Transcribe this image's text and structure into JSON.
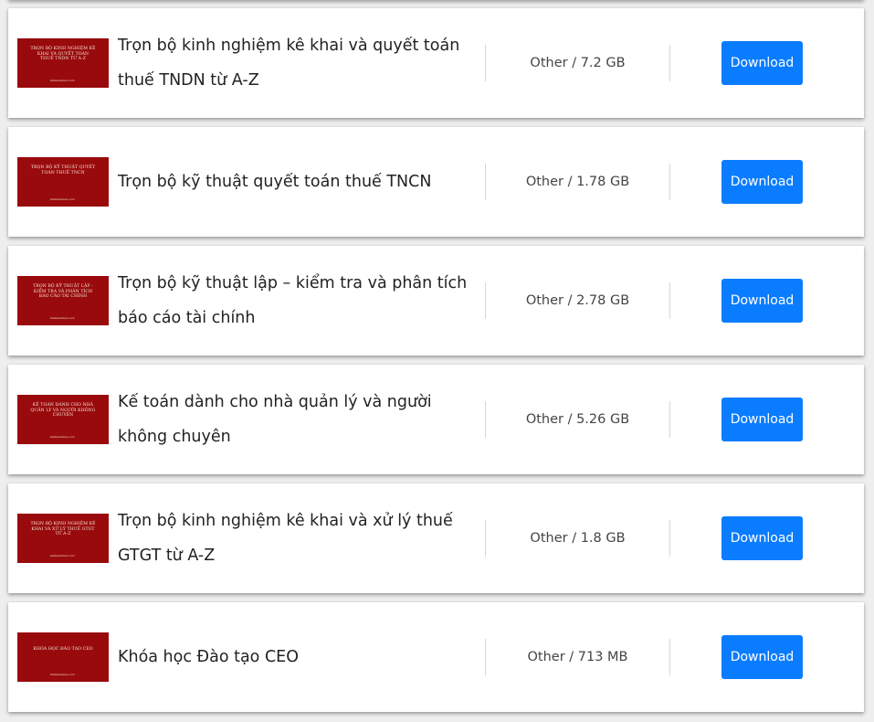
{
  "colors": {
    "button": "#0a7cff",
    "thumbnail": "#990a0d",
    "card": "#ffffff",
    "background": "#eeeeee"
  },
  "items": [
    {
      "title": "Trọn bộ kinh nghiệm kê khai và quyết toán thuế TNDN từ A-Z",
      "meta": "Other / 7.2 GB",
      "button": "Download",
      "thumb_text": "Trọn bộ kinh nghiệm kê khai và quyết toán thuế TNDN từ A-Z",
      "thumb_site": "tailieuketoan.com"
    },
    {
      "title": "Trọn bộ kỹ thuật quyết toán thuế TNCN",
      "meta": "Other / 1.78 GB",
      "button": "Download",
      "thumb_text": "Trọn bộ kỹ thuật quyết toán thuế TNCN",
      "thumb_site": "tailieuketoan.com"
    },
    {
      "title": "Trọn bộ kỹ thuật lập – kiểm tra và phân tích báo cáo tài chính",
      "meta": "Other / 2.78 GB",
      "button": "Download",
      "thumb_text": "Trọn bộ kỹ thuật lập - kiểm tra và phân tích báo cáo tài chính",
      "thumb_site": "tailieuketoan.com"
    },
    {
      "title": "Kế toán dành cho nhà quản lý và người không chuyên",
      "meta": "Other / 5.26 GB",
      "button": "Download",
      "thumb_text": "Kế toán dành cho nhà quản lý và người không chuyên",
      "thumb_site": "tailieuketoan.com"
    },
    {
      "title": "Trọn bộ kinh nghiệm kê khai và xử lý thuế GTGT từ A-Z",
      "meta": "Other / 1.8 GB",
      "button": "Download",
      "thumb_text": "Trọn bộ kinh nghiệm kê khai và xử lý thuế GTGT từ A-Z",
      "thumb_site": "tailieuketoan.com"
    },
    {
      "title": "Khóa học Đào tạo CEO",
      "meta": "Other / 713 MB",
      "button": "Download",
      "thumb_text": "Khóa học Đào tạo CEO",
      "thumb_site": "tailieuketoan.com"
    }
  ]
}
